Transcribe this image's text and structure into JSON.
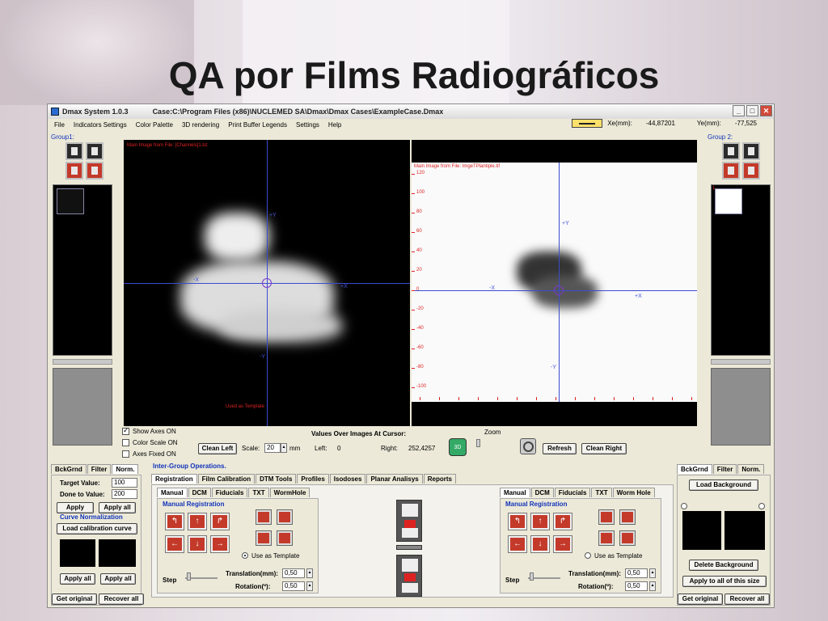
{
  "slide_title": "QA por Films Radiográficos",
  "app": {
    "title": "Dmax System 1.0.3",
    "case_path": "Case:C:\\Program Files (x86)\\NUCLEMED SA\\Dmax\\Dmax Cases\\ExampleCase.Dmax"
  },
  "menu": [
    "File",
    "Indicators Settings",
    "Color Palette",
    "3D rendering",
    "Print Buffer Legends",
    "Settings",
    "Help"
  ],
  "coords": {
    "xe_label": "Xe(mm):",
    "xe_value": "-44,87201",
    "ye_label": "Ye(mm):",
    "ye_value": "-77,525"
  },
  "left_group": {
    "label": "Group1:"
  },
  "right_group": {
    "label": "Group 2:",
    "thumb_index": "1"
  },
  "viewer_left": {
    "header": "Main Image from File: [Channels]1.bz",
    "footer": "Used as Template",
    "axis": {
      "plus_y": "+Y",
      "minus_y": "-Y",
      "minus_x": "-X",
      "plus_x": "+X"
    }
  },
  "viewer_right": {
    "header": "Main Image from File: ImgeTPlantiple.tif",
    "axis": {
      "plus_y": "+Y",
      "minus_y": "-Y",
      "minus_x": "-X",
      "plus_x": "+X"
    },
    "y_ticks": [
      "120",
      "100",
      "80",
      "60",
      "40",
      "20",
      "0",
      "-20",
      "-40",
      "-60",
      "-80",
      "-100"
    ]
  },
  "display": {
    "show_axes": "Show Axes ON",
    "color_scale": "Color Scale ON",
    "axes_fixed": "Axes Fixed ON",
    "clean_left": "Clean Left",
    "scale_label": "Scale:",
    "scale_value": "20",
    "scale_unit": "mm",
    "values_title": "Values Over Images At Cursor:",
    "left_label": "Left:",
    "left_value": "0",
    "right_label": "Right:",
    "right_value": "252,4257",
    "zoom": "Zoom",
    "refresh": "Refresh",
    "clean_right": "Clean Right"
  },
  "left_norm": {
    "tabs": [
      "BckGrnd",
      "Filter",
      "Norm."
    ],
    "target_label": "Target Value:",
    "target_value": "100",
    "done_label": "Done to Value:",
    "done_value": "200",
    "apply": "Apply",
    "apply_all": "Apply all",
    "curve_label": "Curve Normalization",
    "load_curve": "Load calibration curve",
    "apply_all2": "Apply all",
    "apply_all3": "Apply all",
    "get_original": "Get original",
    "recover_all": "Recover all"
  },
  "ops": {
    "title": "Inter-Group Operations.",
    "tabs": [
      "Registration",
      "Film Calibration",
      "DTM Tools",
      "Profiles",
      "Isodoses",
      "Planar Analisys",
      "Reports"
    ],
    "left_subtabs": [
      "Manual",
      "DCM",
      "Fiducials",
      "TXT",
      "WormHole"
    ],
    "right_subtabs": [
      "Manual",
      "DCM",
      "Fiducials",
      "TXT",
      "Worm Hole"
    ],
    "manual_reg": "Manual Registration",
    "use_template": "Use as Template",
    "step": "Step",
    "translation_label": "Translation(mm):",
    "translation_value": "0,50",
    "rotation_label": "Rotation(º):",
    "rotation_value": "0,50"
  },
  "right_panel": {
    "tabs": [
      "BckGrnd",
      "Filter",
      "Norm."
    ],
    "load_background": "Load Background",
    "delete_background": "Delete Background",
    "apply_all_size": "Apply to all of this size",
    "get_original": "Get original",
    "recover_all": "Recover all"
  }
}
